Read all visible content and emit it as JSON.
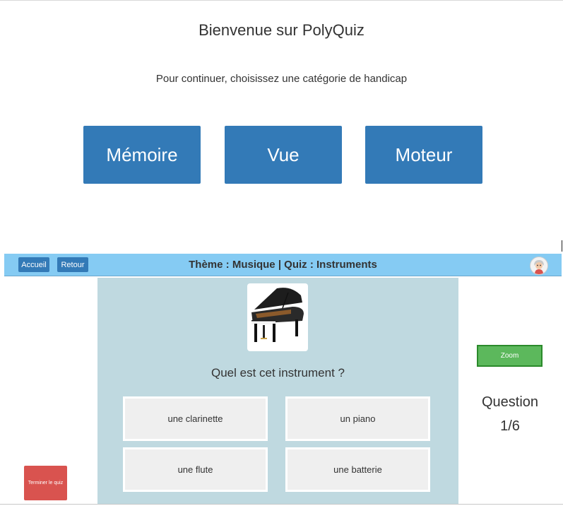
{
  "welcome": {
    "title": "Bienvenue sur PolyQuiz",
    "subtitle": "Pour continuer, choisissez une catégorie de handicap",
    "categories": [
      "Mémoire",
      "Vue",
      "Moteur"
    ]
  },
  "quiz_header": {
    "home_label": "Accueil",
    "back_label": "Retour",
    "theme_text": "Thème : Musique | Quiz : Instruments",
    "avatar_icon": "user-avatar-icon"
  },
  "question": {
    "image_icon": "grand-piano-image",
    "text": "Quel est cet instrument ?",
    "answers": [
      "une clarinette",
      "un piano",
      "une flute",
      "une batterie"
    ]
  },
  "sidebar": {
    "zoom_label": "Zoom",
    "question_label": "Question",
    "question_counter": "1/6"
  },
  "end_quiz_label": "Terminer le quiz",
  "colors": {
    "primary_button": "#337ab7",
    "header_bar": "#85cbf3",
    "panel": "#bfd9e0",
    "zoom_button": "#5cb85c",
    "end_button": "#d9534f"
  }
}
